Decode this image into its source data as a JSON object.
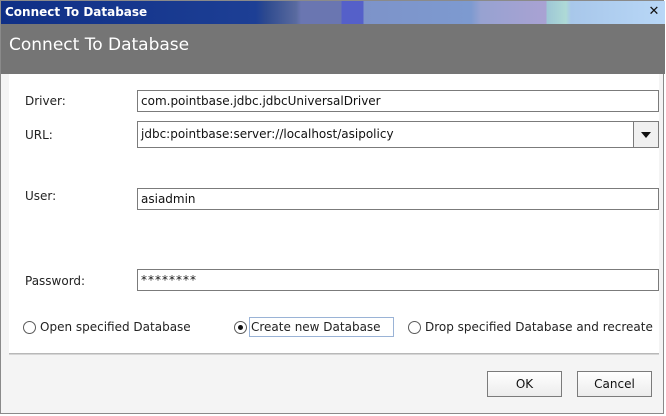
{
  "window": {
    "title": "Connect To Database",
    "close_glyph": "✕"
  },
  "header": {
    "title": "Connect To Database"
  },
  "form": {
    "driver": {
      "label": "Driver:",
      "value": "com.pointbase.jdbc.jdbcUniversalDriver"
    },
    "url": {
      "label": "URL:",
      "value": "jdbc:pointbase:server://localhost/asipolicy"
    },
    "user": {
      "label": "User:",
      "value": "asiadmin"
    },
    "password": {
      "label": "Password:",
      "value": "********"
    }
  },
  "options": [
    {
      "label": "Open specified Database",
      "selected": false
    },
    {
      "label": "Create new Database",
      "selected": true
    },
    {
      "label": "Drop specified Database and recreate",
      "selected": false
    }
  ],
  "buttons": {
    "ok": "OK",
    "cancel": "Cancel"
  },
  "icons": {
    "close": "close-icon",
    "dropdown": "chevron-down-icon"
  }
}
